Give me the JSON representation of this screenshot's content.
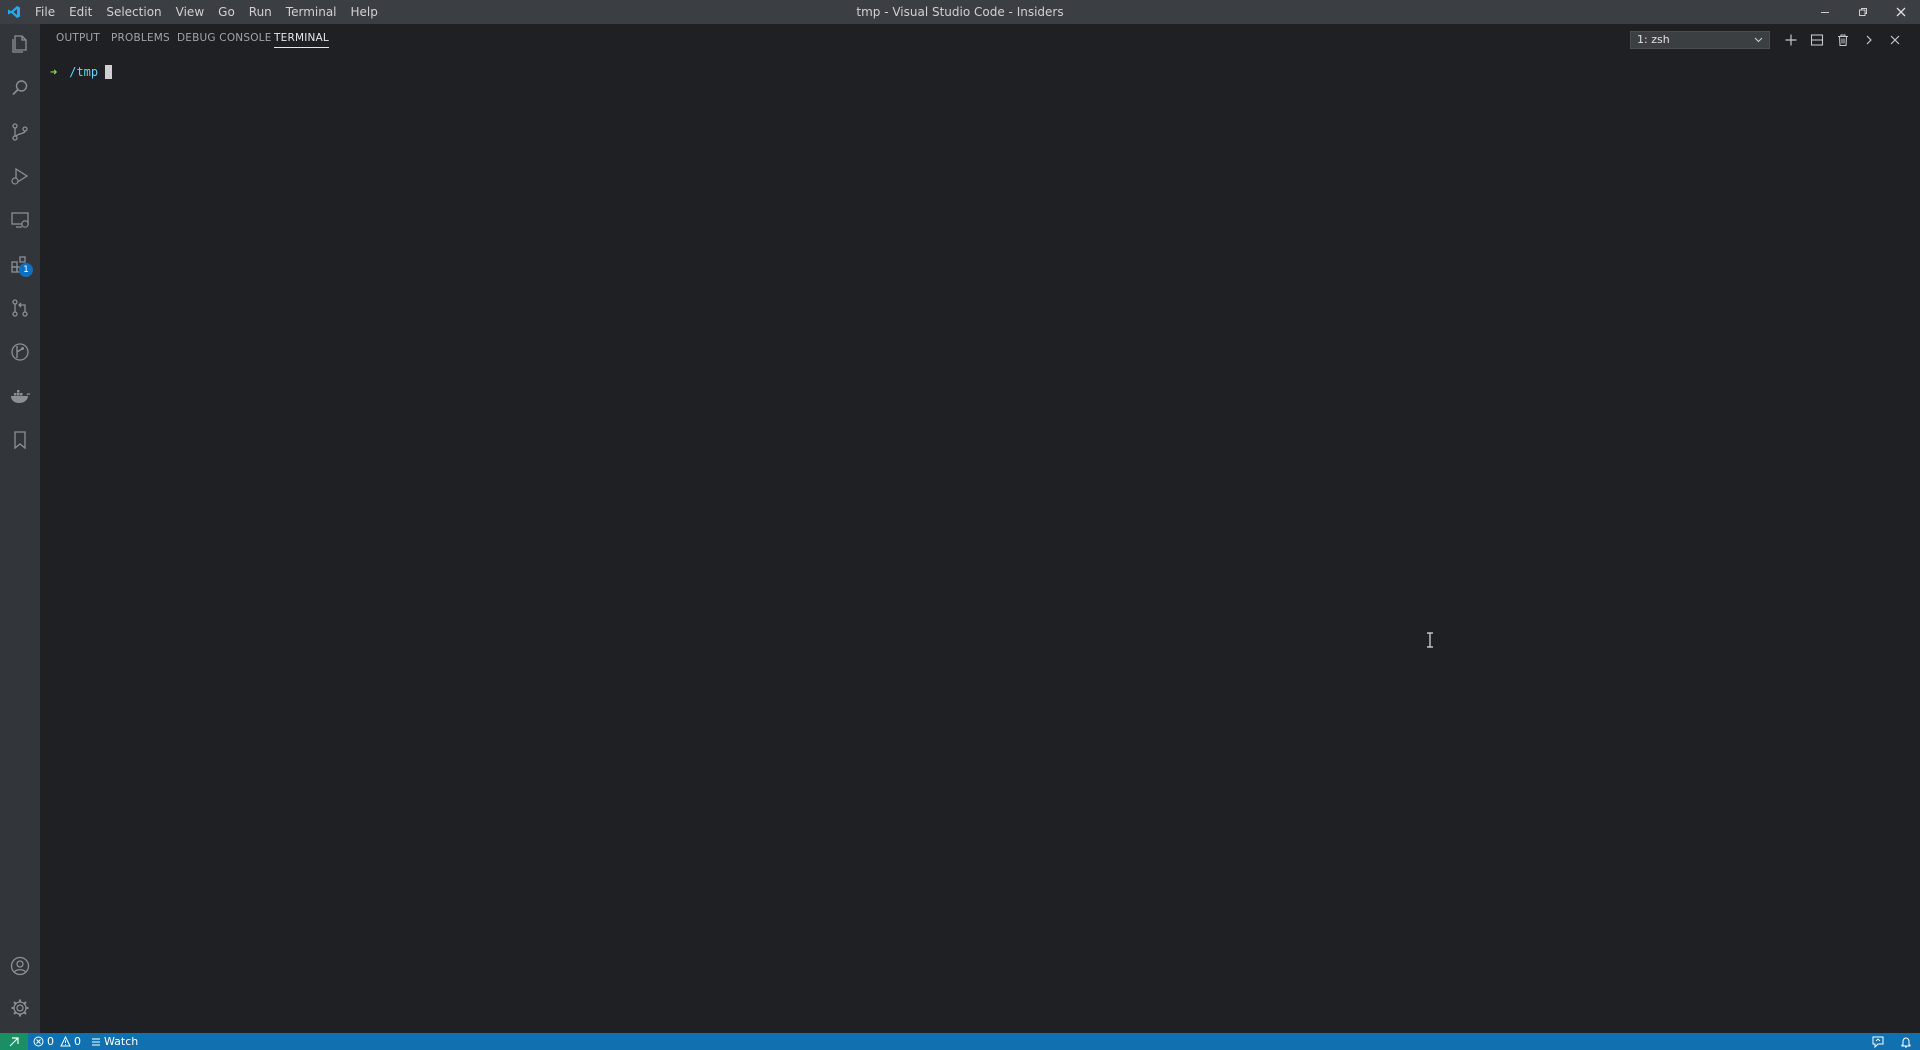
{
  "titlebar": {
    "menu": [
      "File",
      "Edit",
      "Selection",
      "View",
      "Go",
      "Run",
      "Terminal",
      "Help"
    ],
    "window_title": "tmp - Visual Studio Code - Insiders"
  },
  "activitybar": {
    "extensions_badge": "1"
  },
  "panel": {
    "tabs": [
      {
        "label": "OUTPUT",
        "active": false
      },
      {
        "label": "PROBLEMS",
        "active": false
      },
      {
        "label": "DEBUG CONSOLE",
        "active": false
      },
      {
        "label": "TERMINAL",
        "active": true
      }
    ],
    "terminal_selector": "1: zsh"
  },
  "terminal": {
    "prompt_symbol": "➜",
    "cwd": "/tmp"
  },
  "statusbar": {
    "errors": "0",
    "warnings": "0",
    "watch_label": "Watch"
  },
  "colors": {
    "statusbar_bg": "#1070b0",
    "remote_bg": "#1b8e63",
    "prompt_arrow": "#8ae234",
    "prompt_cwd": "#5fd7ff",
    "logo": "#23a9f2"
  }
}
